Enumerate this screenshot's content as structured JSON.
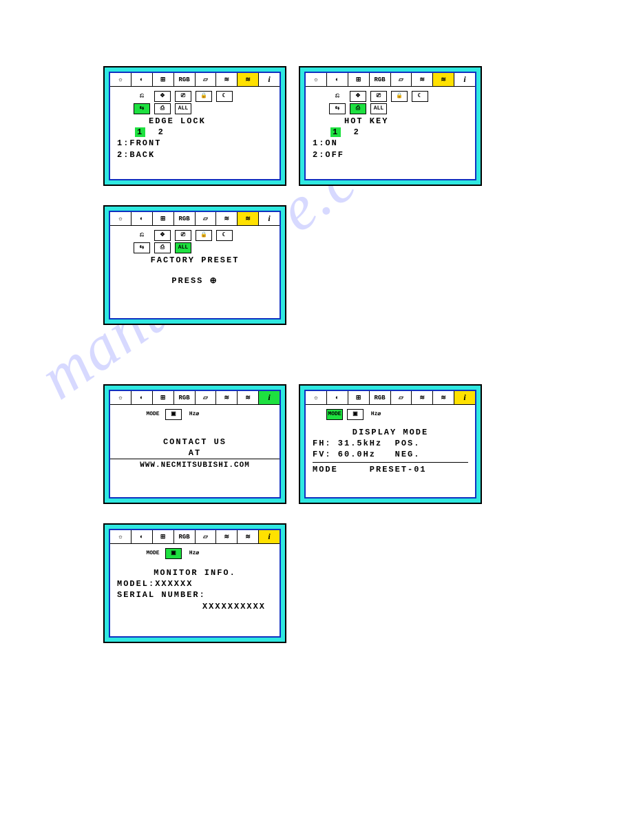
{
  "watermark": "manualslive.com",
  "tabs_main": [
    "☼",
    "◐",
    "⊞",
    "RGB",
    "▱",
    "≋",
    "≋",
    "i"
  ],
  "panels": {
    "edge_lock": {
      "title": "EDGE LOCK",
      "options": "2",
      "opt_selected": "1",
      "line1": "1:FRONT",
      "line2": "2:BACK"
    },
    "hot_key": {
      "title": "HOT KEY",
      "options": "2",
      "opt_selected": "1",
      "line1": "1:ON",
      "line2": "2:OFF"
    },
    "factory_preset": {
      "title": "FACTORY PRESET",
      "action": "PRESS ⊕"
    },
    "contact": {
      "mode_label": "MODE",
      "hz_label": "Hz⌀",
      "title": "CONTACT US",
      "line2": "AT",
      "url": "WWW.NECMITSUBISHI.COM"
    },
    "display_mode": {
      "mode_label": "MODE",
      "hz_label": "Hz⌀",
      "title": "DISPLAY MODE",
      "fh": "FH: 31.5kHz  POS.",
      "fv": "FV: 60.0Hz   NEG.",
      "mode_line": "MODE     PRESET-01"
    },
    "monitor_info": {
      "mode_label": "MODE",
      "hz_label": "Hz⌀",
      "title": "MONITOR INFO.",
      "model": "MODEL:XXXXXX",
      "serial_label": "SERIAL NUMBER:",
      "serial_value": "XXXXXXXXXX"
    }
  },
  "subicons": {
    "row1": [
      "⎌",
      "✥",
      "⎚",
      "🔒",
      "☾"
    ],
    "row2": [
      "⇆",
      "⎙",
      "ALL"
    ]
  }
}
